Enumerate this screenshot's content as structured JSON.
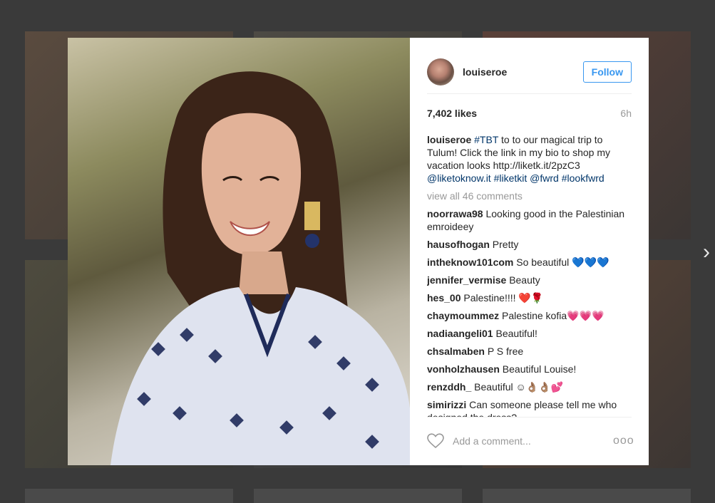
{
  "post": {
    "username": "louiseroe",
    "follow_label": "Follow",
    "likes": "7,402 likes",
    "time": "6h"
  },
  "caption": {
    "user": "louiseroe",
    "hashtag_tbt": "#TBT",
    "text": " to to our magical trip to Tulum! Click the link in my bio to shop my vacation looks http://liketk.it/2pzC3 ",
    "tag_liketoknow": "@liketoknow.it",
    "hashtag_liketkit": "#liketkit",
    "tag_fwrd": "@fwrd",
    "hashtag_lookfwrd": "#lookfwrd"
  },
  "view_all_comments": "view all 46 comments",
  "comments": [
    {
      "user": "noorrawa98",
      "text": "Looking good in the Palestinian emroideey"
    },
    {
      "user": "hausofhogan",
      "text": "Pretty"
    },
    {
      "user": "intheknow101com",
      "text": "So beautiful 💙💙💙"
    },
    {
      "user": "jennifer_vermise",
      "text": "Beauty"
    },
    {
      "user": "hes_00",
      "text": "Palestine!!!! ❤️🌹"
    },
    {
      "user": "chaymoummez",
      "text": "Palestine kofia💗💗💗"
    },
    {
      "user": "nadiaangeli01",
      "text": "Beautiful!"
    },
    {
      "user": "chsalmaben",
      "text": "P S free"
    },
    {
      "user": "vonholzhausen",
      "text": "Beautiful Louise!"
    },
    {
      "user": "renzddh_",
      "text": "Beautiful ☺👌🏽👌🏽💕"
    },
    {
      "user": "simirizzi",
      "text": "Can someone please tell me who designed the dress?"
    }
  ],
  "comment_box": {
    "placeholder": "Add a comment..."
  },
  "more_options": "ooo",
  "next_arrow": "›",
  "colors": {
    "accent": "#3897f0",
    "link": "#003569",
    "muted": "#999999",
    "text": "#262626"
  }
}
